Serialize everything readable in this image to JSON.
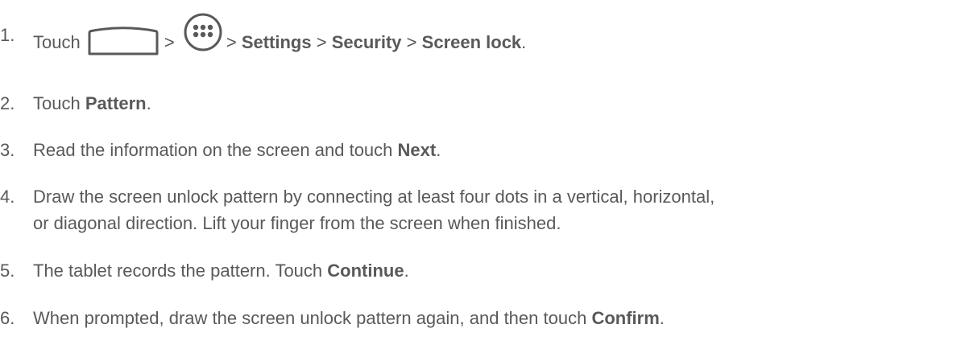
{
  "steps": [
    {
      "number": "1.",
      "parts": {
        "t1": "Touch",
        "sep1": ">",
        "sep2": ">",
        "b1": "Settings",
        "sep3": ">",
        "b2": "Security",
        "sep4": ">",
        "b3": "Screen lock",
        "end": "."
      },
      "icons": [
        "home-icon",
        "apps-icon"
      ]
    },
    {
      "number": "2.",
      "parts": {
        "t1": "Touch ",
        "b1": "Pattern",
        "end": "."
      }
    },
    {
      "number": "3.",
      "parts": {
        "t1": "Read the information on the screen and touch ",
        "b1": "Next",
        "end": "."
      }
    },
    {
      "number": "4.",
      "parts": {
        "line1": "Draw the screen unlock pattern by connecting at least four dots in a vertical, horizontal,",
        "line2": "or diagonal direction. Lift your finger from the screen when finished."
      }
    },
    {
      "number": "5.",
      "parts": {
        "t1": "The tablet records the pattern. Touch ",
        "b1": "Continue",
        "end": "."
      }
    },
    {
      "number": "6.",
      "parts": {
        "t1": "When prompted, draw the screen unlock pattern again, and then touch ",
        "b1": "Confirm",
        "end": "."
      }
    }
  ],
  "colors": {
    "text": "#595959",
    "icon": "#595959"
  }
}
